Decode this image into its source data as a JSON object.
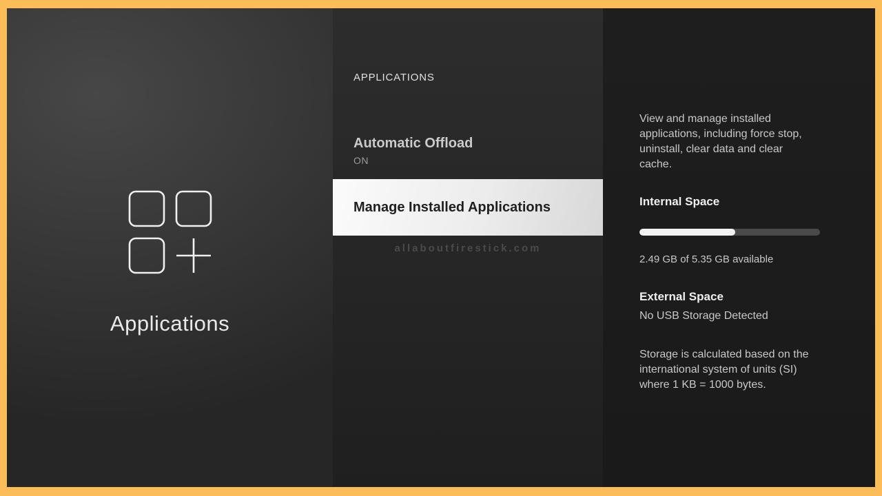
{
  "colors": {
    "frame": "#fcbd59",
    "selected_row_bg": "#ececec",
    "progress_fill": "#f2f2f2",
    "progress_track": "#4a4a4a"
  },
  "left_panel": {
    "icon": "apps-grid-plus",
    "title": "Applications"
  },
  "menu": {
    "header": "APPLICATIONS",
    "items": [
      {
        "label": "Automatic Offload",
        "status": "ON",
        "selected": false
      },
      {
        "label": "Manage Installed Applications",
        "selected": true
      }
    ]
  },
  "watermark": "allaboutfirestick.com",
  "details": {
    "description": "View and manage installed applications, including force stop, uninstall, clear data and clear cache.",
    "internal_space": {
      "label": "Internal Space",
      "available": "2.49 GB of 5.35 GB available",
      "progress_percent": 53
    },
    "external_space": {
      "label": "External Space",
      "status": "No USB Storage Detected"
    },
    "note": "Storage is calculated based on the international system of units (SI) where 1 KB = 1000 bytes."
  }
}
